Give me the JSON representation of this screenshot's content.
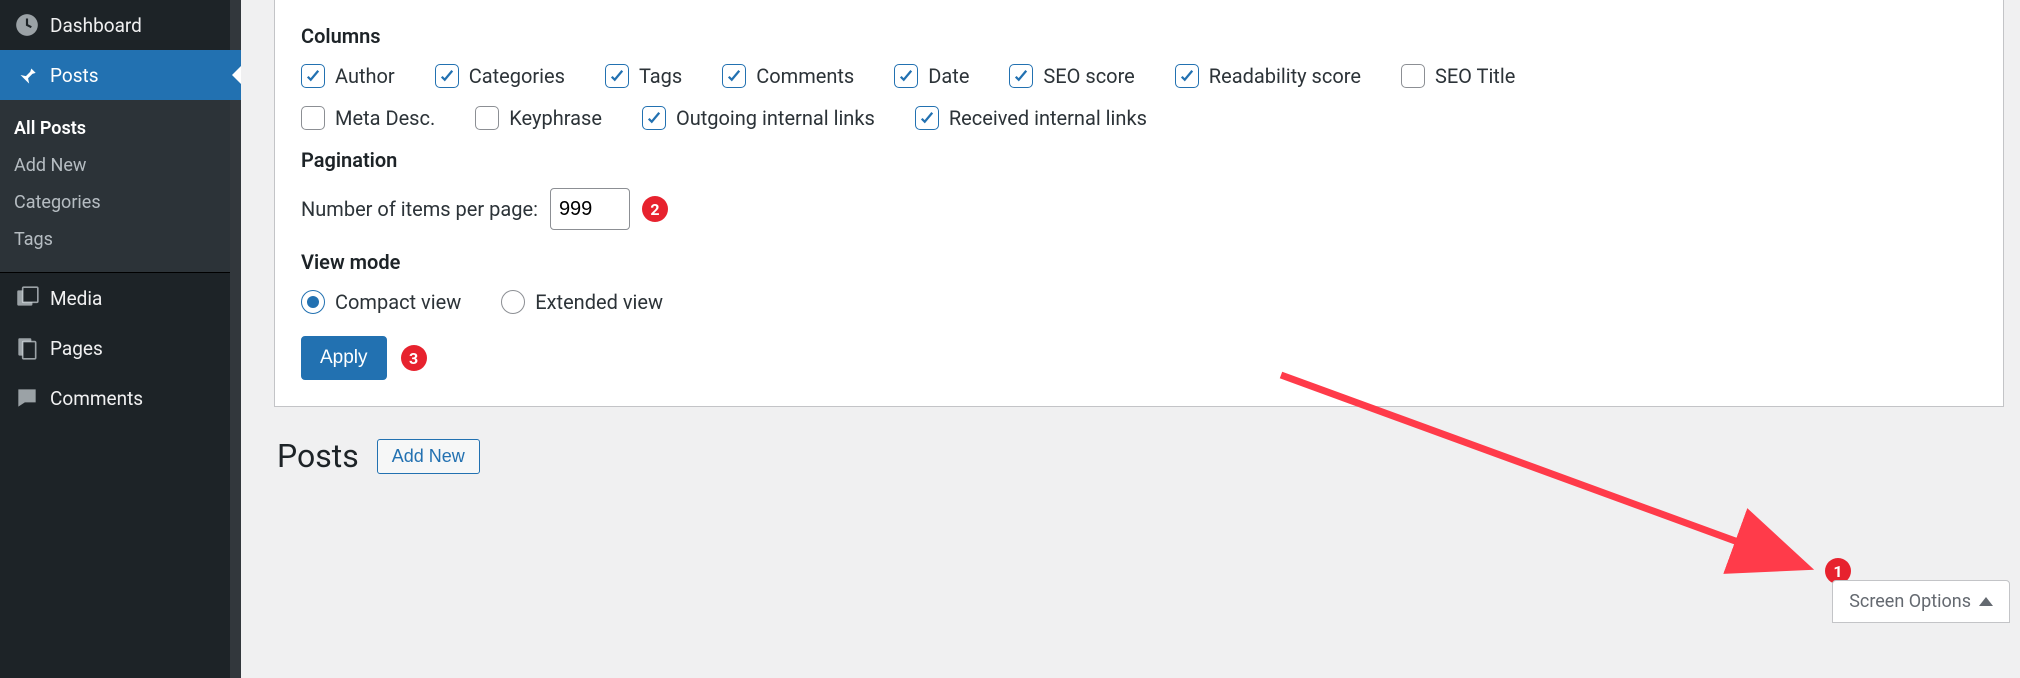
{
  "sidebar": {
    "dashboard": "Dashboard",
    "posts": "Posts",
    "sub": {
      "all_posts": "All Posts",
      "add_new": "Add New",
      "categories": "Categories",
      "tags": "Tags"
    },
    "media": "Media",
    "pages": "Pages",
    "comments": "Comments"
  },
  "panel": {
    "columns_legend": "Columns",
    "pagination_legend": "Pagination",
    "viewmode_legend": "View mode",
    "items_label": "Number of items per page:",
    "items_value": "999",
    "apply": "Apply",
    "cols": {
      "author": {
        "label": "Author",
        "checked": true
      },
      "categories": {
        "label": "Categories",
        "checked": true
      },
      "tags": {
        "label": "Tags",
        "checked": true
      },
      "comments": {
        "label": "Comments",
        "checked": true
      },
      "date": {
        "label": "Date",
        "checked": true
      },
      "seo_score": {
        "label": "SEO score",
        "checked": true
      },
      "readability": {
        "label": "Readability score",
        "checked": true
      },
      "seo_title": {
        "label": "SEO Title",
        "checked": false
      },
      "meta_desc": {
        "label": "Meta Desc.",
        "checked": false
      },
      "keyphrase": {
        "label": "Keyphrase",
        "checked": false
      },
      "out_links": {
        "label": "Outgoing internal links",
        "checked": true
      },
      "in_links": {
        "label": "Received internal links",
        "checked": true
      }
    },
    "viewmodes": {
      "compact": {
        "label": "Compact view",
        "selected": true
      },
      "extended": {
        "label": "Extended view",
        "selected": false
      }
    }
  },
  "screen_tab": "Screen Options",
  "page": {
    "title": "Posts",
    "add_new": "Add New"
  },
  "annotations": {
    "n1": "1",
    "n2": "2",
    "n3": "3"
  }
}
